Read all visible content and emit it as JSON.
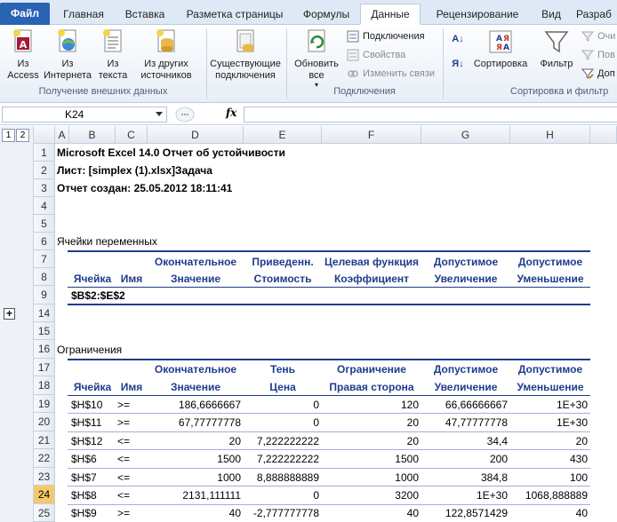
{
  "tabs": [
    {
      "label": "Файл"
    },
    {
      "label": "Главная"
    },
    {
      "label": "Вставка"
    },
    {
      "label": "Разметка страницы"
    },
    {
      "label": "Формулы"
    },
    {
      "label": "Данные"
    },
    {
      "label": "Рецензирование"
    },
    {
      "label": "Вид"
    },
    {
      "label": "Разраб"
    }
  ],
  "ribbon": {
    "from_access": "Из\nAccess",
    "from_web": "Из\nИнтернета",
    "from_text": "Из\nтекста",
    "from_other": "Из других\nисточников",
    "existing": "Существующие\nподключения",
    "refresh_all": "Обновить\nвсе",
    "connections": "Подключения",
    "properties": "Свойства",
    "edit_links": "Изменить связи",
    "sort_az": "А↓",
    "sort_za": "Я↓",
    "sort": "Сортировка",
    "filter": "Фильтр",
    "clear": "Очи",
    "reapply": "Пов",
    "advanced": "Доп",
    "group_external": "Получение внешних данных",
    "group_connections": "Подключения",
    "group_sort": "Сортировка и фильтр"
  },
  "formula_bar": {
    "name_box": "K24",
    "fx": "fx",
    "value": ""
  },
  "outline": {
    "level1": "1",
    "level2": "2",
    "expand": "+"
  },
  "columns": [
    "A",
    "B",
    "C",
    "D",
    "E",
    "F",
    "G",
    "H"
  ],
  "rows": {
    "r1": "1",
    "r2": "2",
    "r3": "3",
    "r4": "4",
    "r5": "5",
    "r6": "6",
    "r7": "7",
    "r8": "8",
    "r9": "9",
    "r14": "14",
    "r15": "15",
    "r16": "16",
    "r17": "17",
    "r18": "18",
    "r19": "19",
    "r20": "20",
    "r21": "21",
    "r22": "22",
    "r23": "23",
    "r24": "24",
    "r25": "25"
  },
  "report": {
    "title": "Microsoft Excel 14.0 Отчет об устойчивости",
    "sheet": "Лист: [simplex (1).xlsx]Задача",
    "created": "Отчет создан: 25.05.2012 18:11:41",
    "variables_section": "Ячейки переменных",
    "constraints_section": "Ограничения",
    "var_headers_top": {
      "d": "Окончательное",
      "e": "Приведенн.",
      "f": "Целевая функция",
      "g": "Допустимое",
      "h": "Допустимое"
    },
    "var_headers_bottom": {
      "b": "Ячейка",
      "c": "Имя",
      "d": "Значение",
      "e": "Стоимость",
      "f": "Коэффициент",
      "g": "Увеличение",
      "h": "Уменьшение"
    },
    "var_row": "$B$2:$E$2",
    "con_headers_top": {
      "d": "Окончательное",
      "e": "Тень",
      "f": "Ограничение",
      "g": "Допустимое",
      "h": "Допустимое"
    },
    "con_headers_bottom": {
      "b": "Ячейка",
      "c": "Имя",
      "d": "Значение",
      "e": "Цена",
      "f": "Правая сторона",
      "g": "Увеличение",
      "h": "Уменьшение"
    },
    "constraints": [
      {
        "cell": "$H$10",
        "name": ">=",
        "value": "186,6666667",
        "price": "0",
        "rhs": "120",
        "inc": "66,66666667",
        "dec": "1E+30"
      },
      {
        "cell": "$H$11",
        "name": ">=",
        "value": "67,77777778",
        "price": "0",
        "rhs": "20",
        "inc": "47,77777778",
        "dec": "1E+30"
      },
      {
        "cell": "$H$12",
        "name": "<=",
        "value": "20",
        "price": "7,222222222",
        "rhs": "20",
        "inc": "34,4",
        "dec": "20"
      },
      {
        "cell": "$H$6",
        "name": "<=",
        "value": "1500",
        "price": "7,222222222",
        "rhs": "1500",
        "inc": "200",
        "dec": "430"
      },
      {
        "cell": "$H$7",
        "name": "<=",
        "value": "1000",
        "price": "8,888888889",
        "rhs": "1000",
        "inc": "384,8",
        "dec": "100"
      },
      {
        "cell": "$H$8",
        "name": "<=",
        "value": "2131,111111",
        "price": "0",
        "rhs": "3200",
        "inc": "1E+30",
        "dec": "1068,888889"
      },
      {
        "cell": "$H$9",
        "name": ">=",
        "value": "40",
        "price": "-2,777777778",
        "rhs": "40",
        "inc": "122,8571429",
        "dec": "40"
      }
    ]
  },
  "colors": {
    "file_tab": "#2a62b4",
    "header_text": "#1f3c8c",
    "selected_row": "#f5c86b"
  }
}
